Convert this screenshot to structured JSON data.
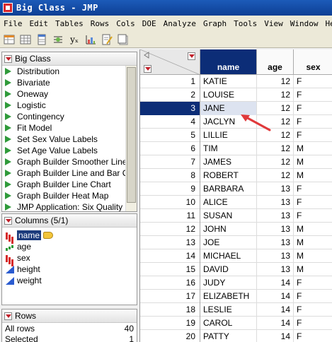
{
  "window": {
    "title": "Big Class - JMP"
  },
  "menu": [
    "File",
    "Edit",
    "Tables",
    "Rows",
    "Cols",
    "DOE",
    "Analyze",
    "Graph",
    "Tools",
    "View",
    "Window",
    "Help"
  ],
  "toolbar": {
    "icons": [
      "open-table-icon",
      "data-grid-icon",
      "column-icon",
      "insert-formula-icon",
      "bar-chart-icon",
      "script-icon",
      "new-table-icon"
    ],
    "xbar_glyph": "yₓ"
  },
  "table_panel": {
    "title": "Big Class",
    "scripts": [
      "Distribution",
      "Bivariate",
      "Oneway",
      "Logistic",
      "Contingency",
      "Fit Model",
      "Set Sex Value Labels",
      "Set Age Value Labels",
      "Graph Builder Smoother Line",
      "Graph Builder Line and Bar Ch",
      "Graph Builder Line Chart",
      "Graph Builder Heat Map",
      "JMP Application: Six Quality ("
    ]
  },
  "columns_panel": {
    "title": "Columns (5/1)",
    "columns": [
      {
        "name": "name",
        "type": "nominal"
      },
      {
        "name": "age",
        "type": "ordinal"
      },
      {
        "name": "sex",
        "type": "nominal"
      },
      {
        "name": "height",
        "type": "continuous"
      },
      {
        "name": "weight",
        "type": "continuous"
      }
    ]
  },
  "rows_panel": {
    "title": "Rows",
    "lines": [
      {
        "label": "All rows",
        "value": "40"
      },
      {
        "label": "Selected",
        "value": "1"
      }
    ]
  },
  "grid": {
    "headers": {
      "name": "name",
      "age": "age",
      "sex": "sex"
    },
    "rows": [
      {
        "n": "1",
        "name": "KATIE",
        "age": "12",
        "sex": "F"
      },
      {
        "n": "2",
        "name": "LOUISE",
        "age": "12",
        "sex": "F"
      },
      {
        "n": "3",
        "name": "JANE",
        "age": "12",
        "sex": "F"
      },
      {
        "n": "4",
        "name": "JACLYN",
        "age": "12",
        "sex": "F"
      },
      {
        "n": "5",
        "name": "LILLIE",
        "age": "12",
        "sex": "F"
      },
      {
        "n": "6",
        "name": "TIM",
        "age": "12",
        "sex": "M"
      },
      {
        "n": "7",
        "name": "JAMES",
        "age": "12",
        "sex": "M"
      },
      {
        "n": "8",
        "name": "ROBERT",
        "age": "12",
        "sex": "M"
      },
      {
        "n": "9",
        "name": "BARBARA",
        "age": "13",
        "sex": "F"
      },
      {
        "n": "10",
        "name": "ALICE",
        "age": "13",
        "sex": "F"
      },
      {
        "n": "11",
        "name": "SUSAN",
        "age": "13",
        "sex": "F"
      },
      {
        "n": "12",
        "name": "JOHN",
        "age": "13",
        "sex": "M"
      },
      {
        "n": "13",
        "name": "JOE",
        "age": "13",
        "sex": "M"
      },
      {
        "n": "14",
        "name": "MICHAEL",
        "age": "13",
        "sex": "M"
      },
      {
        "n": "15",
        "name": "DAVID",
        "age": "13",
        "sex": "M"
      },
      {
        "n": "16",
        "name": "JUDY",
        "age": "14",
        "sex": "F"
      },
      {
        "n": "17",
        "name": "ELIZABETH",
        "age": "14",
        "sex": "F"
      },
      {
        "n": "18",
        "name": "LESLIE",
        "age": "14",
        "sex": "F"
      },
      {
        "n": "19",
        "name": "CAROL",
        "age": "14",
        "sex": "F"
      },
      {
        "n": "20",
        "name": "PATTY",
        "age": "14",
        "sex": "F"
      }
    ],
    "selected_row": "3"
  },
  "colors": {
    "selection": "#0c2d77",
    "annotation_arrow": "#e0393b",
    "play_icon": "#2f9a3a"
  }
}
